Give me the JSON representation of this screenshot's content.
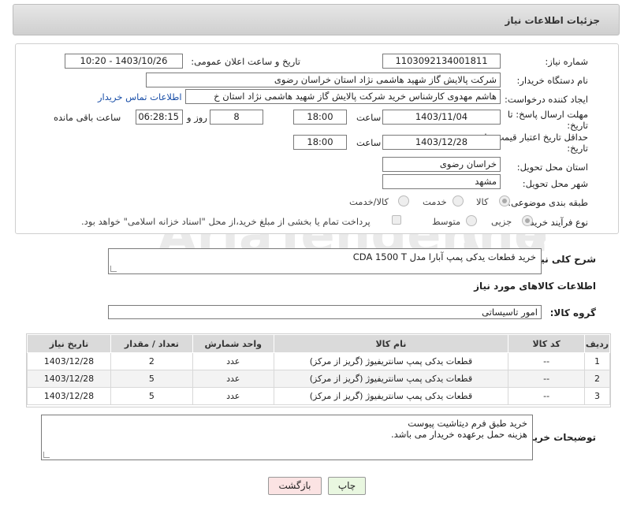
{
  "header": {
    "title": "جزئیات اطلاعات نیاز"
  },
  "form": {
    "need_number_label": "شماره نیاز:",
    "need_number": "1103092134001811",
    "announce_label": "تاریخ و ساعت اعلان عمومی:",
    "announce_value": "1403/10/26 - 10:20",
    "buyer_org_label": "نام دستگاه خریدار:",
    "buyer_org": "شرکت پالایش گاز شهید هاشمی نژاد   استان خراسان رضوی",
    "creator_label": "ایجاد کننده درخواست:",
    "creator": "هاشم مهدوی کارشناس خرید شرکت پالایش گاز شهید هاشمی نژاد   استان خ",
    "contact_link": "اطلاعات تماس خریدار",
    "reply_deadline_label_1": "مهلت ارسال پاسخ: تا",
    "reply_deadline_label_2": "تاریخ:",
    "reply_date": "1403/11/04",
    "time_label": "ساعت",
    "reply_time": "18:00",
    "days_value": "8",
    "days_label": "روز و",
    "remaining_value": "06:28:15",
    "remaining_label": "ساعت باقی مانده",
    "price_validity_label_1": "حداقل تاریخ اعتبار قیمت: تا",
    "price_validity_label_2": "تاریخ:",
    "price_date": "1403/12/28",
    "price_time": "18:00",
    "province_label": "استان محل تحویل:",
    "province": "خراسان رضوی",
    "city_label": "شهر محل تحویل:",
    "city": "مشهد",
    "category_label": "طبقه بندی موضوعی:",
    "category_options": [
      "کالا",
      "خدمت",
      "کالا/خدمت"
    ],
    "process_label": "نوع فرآیند خرید :",
    "process_options": [
      "جزیی",
      "متوسط"
    ],
    "payment_note": "پرداخت تمام یا بخشی از مبلغ خرید،از محل \"اسناد خزانه اسلامی\" خواهد بود."
  },
  "summary": {
    "label": "شرح کلی نیاز:",
    "value": "خرید قطعات یدکی پمپ آبارا مدل CDA 1500 T"
  },
  "goods": {
    "section_title": "اطلاعات کالاهای مورد نیاز",
    "group_label": "گروه کالا:",
    "group_value": "امور تاسیساتی",
    "columns": [
      "ردیف",
      "کد کالا",
      "نام کالا",
      "واحد شمارش",
      "تعداد / مقدار",
      "تاریخ نیاز"
    ],
    "rows": [
      [
        "1",
        "--",
        "قطعات یدکی پمپ سانتریفیوژ (گریز از مرکز)",
        "عدد",
        "2",
        "1403/12/28"
      ],
      [
        "2",
        "--",
        "قطعات یدکی پمپ سانتریفیوژ (گریز از مرکز)",
        "عدد",
        "5",
        "1403/12/28"
      ],
      [
        "3",
        "--",
        "قطعات یدکی پمپ سانتریفیوژ (گریز از مرکز)",
        "عدد",
        "5",
        "1403/12/28"
      ]
    ]
  },
  "buyer_notes": {
    "label": "توضیحات خریدار:",
    "line1": "خرید طبق فرم دیتاشیت پیوست",
    "line2": "هزینه حمل برعهده خریدار می باشد."
  },
  "buttons": {
    "print": "چاپ",
    "back": "بازگشت"
  },
  "watermark": "AriaTender.neT",
  "colors": {
    "link": "#1a4fa8",
    "print_bg": "#e9f7e0",
    "back_bg": "#fbe3e3"
  }
}
